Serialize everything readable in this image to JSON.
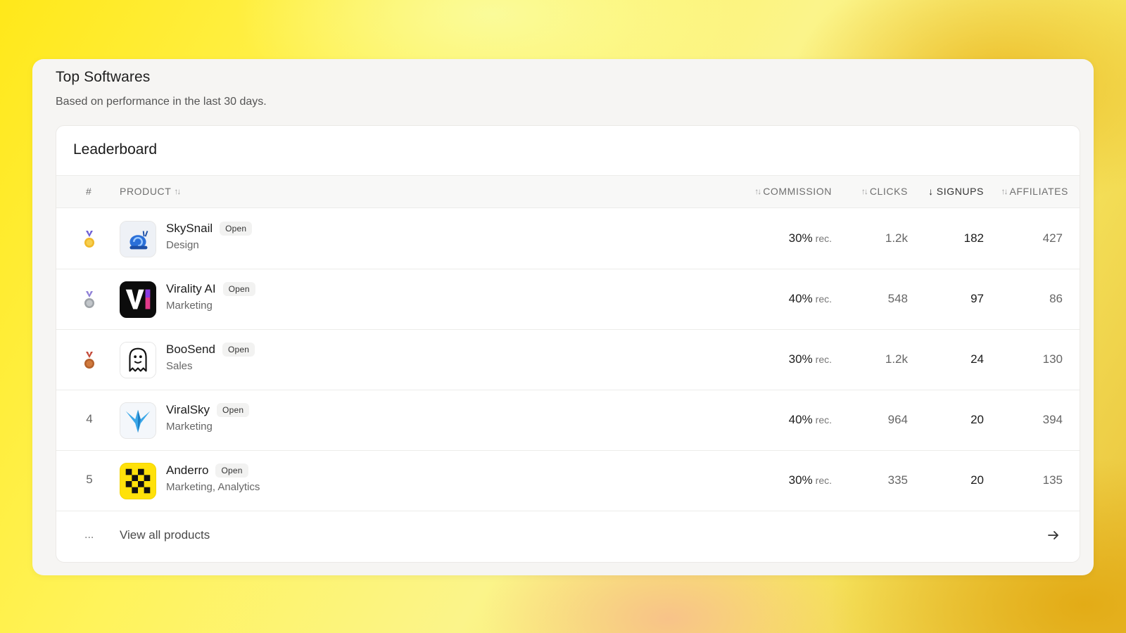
{
  "section": {
    "title": "Top Softwares",
    "subtitle": "Based on performance in the last 30 days."
  },
  "leaderboard": {
    "title": "Leaderboard",
    "columns": {
      "rank": "#",
      "product": "PRODUCT",
      "commission": "COMMISSION",
      "clicks": "CLICKS",
      "signups": "SIGNUPS",
      "affiliates": "AFFILIATES"
    },
    "sorted_by": "signups",
    "sort_direction": "descending",
    "rows": [
      {
        "rank": "1",
        "rank_icon": "gold-medal-icon",
        "name": "SkySnail",
        "status": "Open",
        "category": "Design",
        "commission": "30%",
        "commission_type": "rec.",
        "clicks": "1.2k",
        "signups": "182",
        "affiliates": "427",
        "logo_icon": "snail-logo-icon"
      },
      {
        "rank": "2",
        "rank_icon": "silver-medal-icon",
        "name": "Virality AI",
        "status": "Open",
        "category": "Marketing",
        "commission": "40%",
        "commission_type": "rec.",
        "clicks": "548",
        "signups": "97",
        "affiliates": "86",
        "logo_icon": "vi-logo-icon"
      },
      {
        "rank": "3",
        "rank_icon": "bronze-medal-icon",
        "name": "BooSend",
        "status": "Open",
        "category": "Sales",
        "commission": "30%",
        "commission_type": "rec.",
        "clicks": "1.2k",
        "signups": "24",
        "affiliates": "130",
        "logo_icon": "ghost-logo-icon"
      },
      {
        "rank": "4",
        "name": "ViralSky",
        "status": "Open",
        "category": "Marketing",
        "commission": "40%",
        "commission_type": "rec.",
        "clicks": "964",
        "signups": "20",
        "affiliates": "394",
        "logo_icon": "rocket-v-logo-icon"
      },
      {
        "rank": "5",
        "name": "Anderro",
        "status": "Open",
        "category": "Marketing, Analytics",
        "commission": "30%",
        "commission_type": "rec.",
        "clicks": "335",
        "signups": "20",
        "affiliates": "135",
        "logo_icon": "checker-logo-icon"
      }
    ],
    "footer": {
      "ellipsis": "...",
      "view_all": "View all products"
    }
  },
  "colors": {
    "gold": "#f0b92b",
    "silver": "#9ea3a8",
    "bronze": "#b5612c",
    "accent_yellow": "#ffe81a"
  }
}
